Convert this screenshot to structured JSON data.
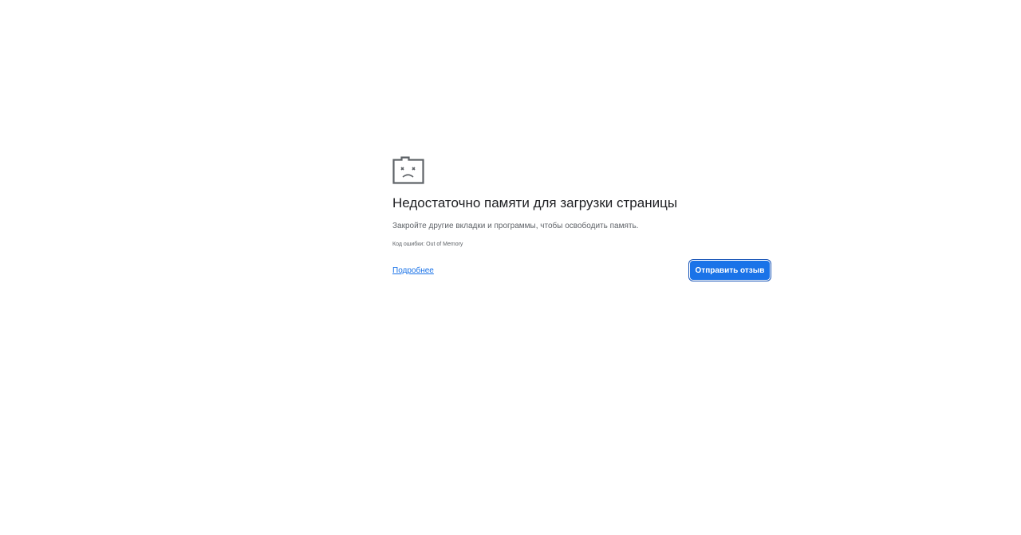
{
  "error_page": {
    "icon": "sad-tab-icon",
    "title": "Недостаточно памяти для загрузки страницы",
    "message": "Закройте другие вкладки и программы, чтобы освободить память.",
    "error_code": "Код ошибки: Out of Memory",
    "learn_more_label": "Подробнее",
    "feedback_button_label": "Отправить отзыв"
  },
  "colors": {
    "background": "#ffffff",
    "title": "#202124",
    "secondary_text": "#5f6368",
    "link": "#1a73e8",
    "button": "#1a73e8",
    "button_text": "#ffffff"
  }
}
